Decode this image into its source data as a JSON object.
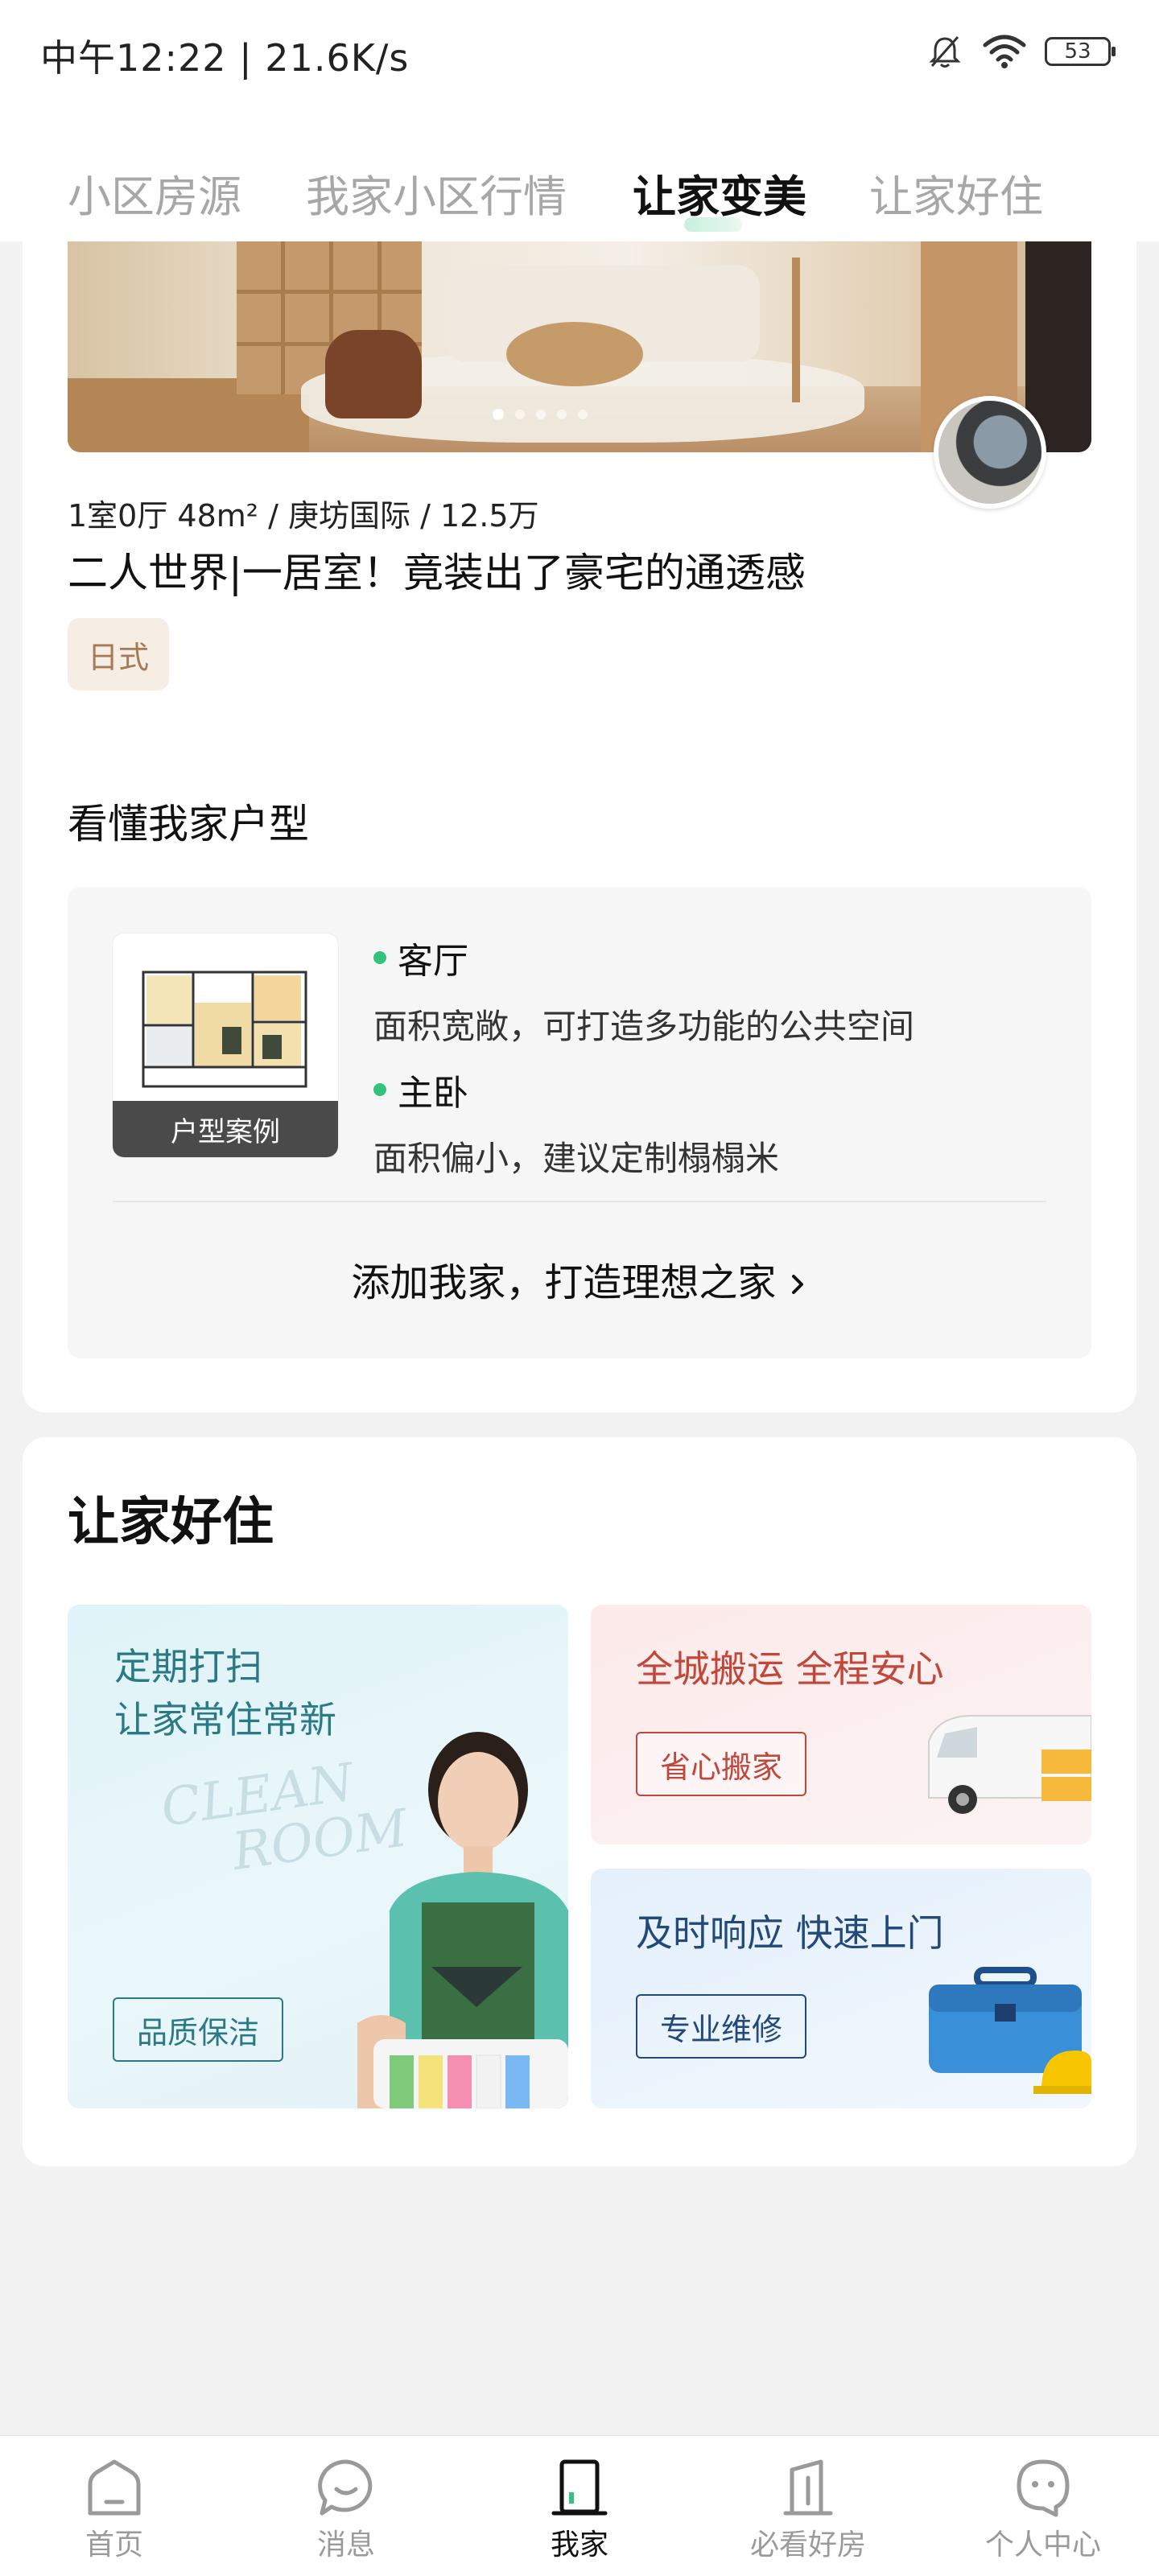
{
  "status_bar": {
    "time_speed": "中午12:22 | 21.6K/s",
    "battery": "53",
    "icons": [
      "bell-muted-icon",
      "wifi-icon",
      "battery-icon"
    ]
  },
  "tabs": [
    {
      "label": "小区房源",
      "active": false
    },
    {
      "label": "我家小区行情",
      "active": false
    },
    {
      "label": "让家变美",
      "active": true
    },
    {
      "label": "让家好住",
      "active": false
    }
  ],
  "design_case": {
    "meta": "1室0厅 48m² / 庚坊国际 / 12.5万",
    "title": "二人世界|一居室！竟装出了豪宅的通透感",
    "style_tag": "日式",
    "carousel_count": 5,
    "carousel_active": 1
  },
  "floorplan": {
    "section_title": "看懂我家户型",
    "thumb_caption": "户型案例",
    "rooms": [
      {
        "name": "客厅",
        "desc": "面积宽敞，可打造多功能的公共空间"
      },
      {
        "name": "主卧",
        "desc": "面积偏小，建议定制榻榻米"
      }
    ],
    "cta": "添加我家，打造理想之家"
  },
  "services": {
    "title": "让家好住",
    "cleaning": {
      "headline_1": "定期打扫",
      "headline_2": "让家常住常新",
      "watermark_1": "CLEAN",
      "watermark_2": "ROOM",
      "button": "品质保洁"
    },
    "moving": {
      "headline": "全城搬运 全程安心",
      "button": "省心搬家"
    },
    "repair": {
      "headline": "及时响应 快速上门",
      "button": "专业维修"
    }
  },
  "bottom_nav": [
    {
      "label": "首页",
      "icon": "home-icon",
      "active": false
    },
    {
      "label": "消息",
      "icon": "message-icon",
      "active": false
    },
    {
      "label": "我家",
      "icon": "door-icon",
      "active": true
    },
    {
      "label": "必看好房",
      "icon": "building-icon",
      "active": false
    },
    {
      "label": "个人中心",
      "icon": "profile-icon",
      "active": false
    }
  ],
  "colors": {
    "accent_green": "#34c17a",
    "clean_teal": "#2a7a86",
    "move_red": "#c2473b",
    "repair_blue": "#22497a"
  }
}
